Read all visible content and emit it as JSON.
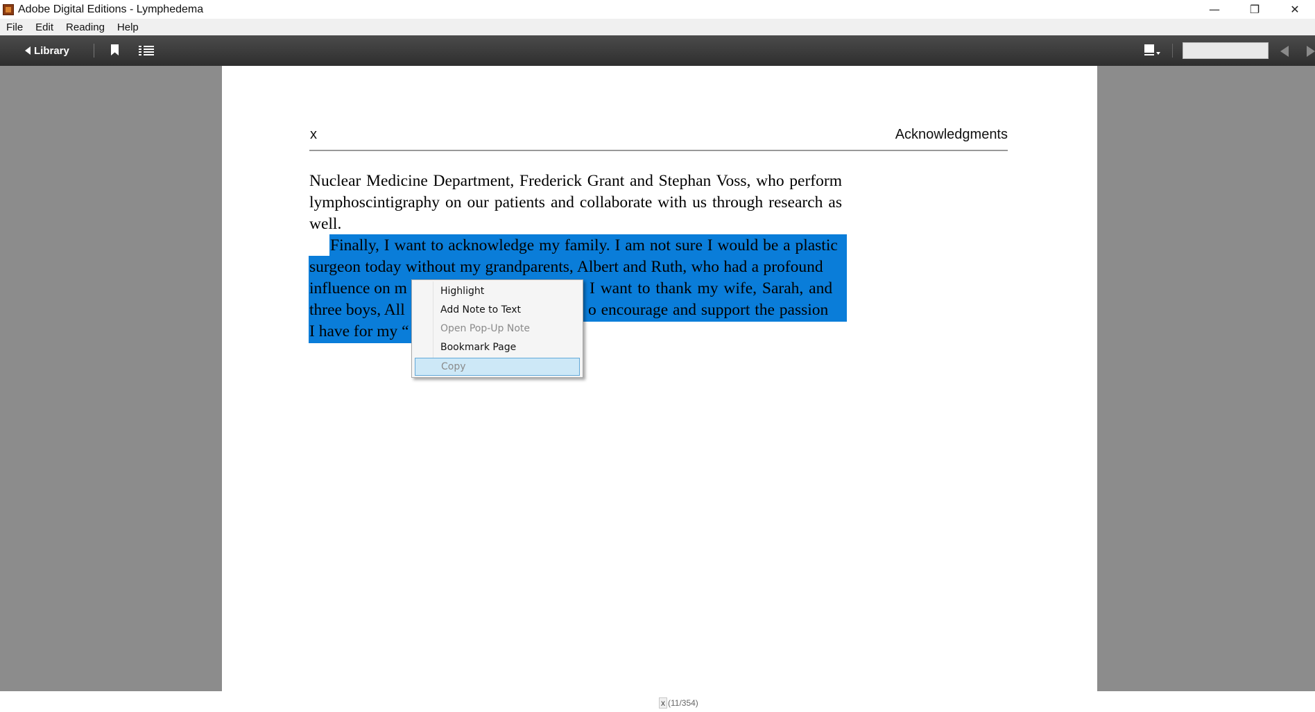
{
  "window": {
    "title": "Adobe Digital Editions - Lymphedema",
    "controls": {
      "minimize": "—",
      "restore": "❐",
      "close": "✕"
    }
  },
  "menu": [
    "File",
    "Edit",
    "Reading",
    "Help"
  ],
  "toolbar": {
    "library_label": "Library",
    "page_input_value": ""
  },
  "page": {
    "header_left": "x",
    "header_right": "Acknowledgments",
    "paragraph1": "Nuclear Medicine Department, Frederick Grant and Stephan Voss, who perform lymphoscintigraphy on our patients and collaborate with us through research as well.",
    "selected_lines": [
      "Finally, I want to acknowledge my family. I am not sure I would be a plastic",
      "surgeon today without my grandparents, Albert and Ruth, who had a profound",
      "influence on m",
      "I want to thank my wife, Sarah, and",
      "three boys, All",
      "o encourage and support the passion",
      "I have for my “"
    ]
  },
  "context_menu": {
    "items": [
      {
        "label": "Highlight",
        "state": "enabled"
      },
      {
        "label": "Add Note to Text",
        "state": "enabled"
      },
      {
        "label": "Open Pop-Up Note",
        "state": "disabled"
      },
      {
        "label": "Bookmark Page",
        "state": "enabled"
      },
      {
        "label": "Copy",
        "state": "hover"
      }
    ]
  },
  "status": {
    "chapter_chip": "x",
    "position": "(11/354)"
  },
  "colors": {
    "selection": "#0a7dd9",
    "toolbar": "#3a3a3a",
    "workspace": "#8c8c8c"
  }
}
